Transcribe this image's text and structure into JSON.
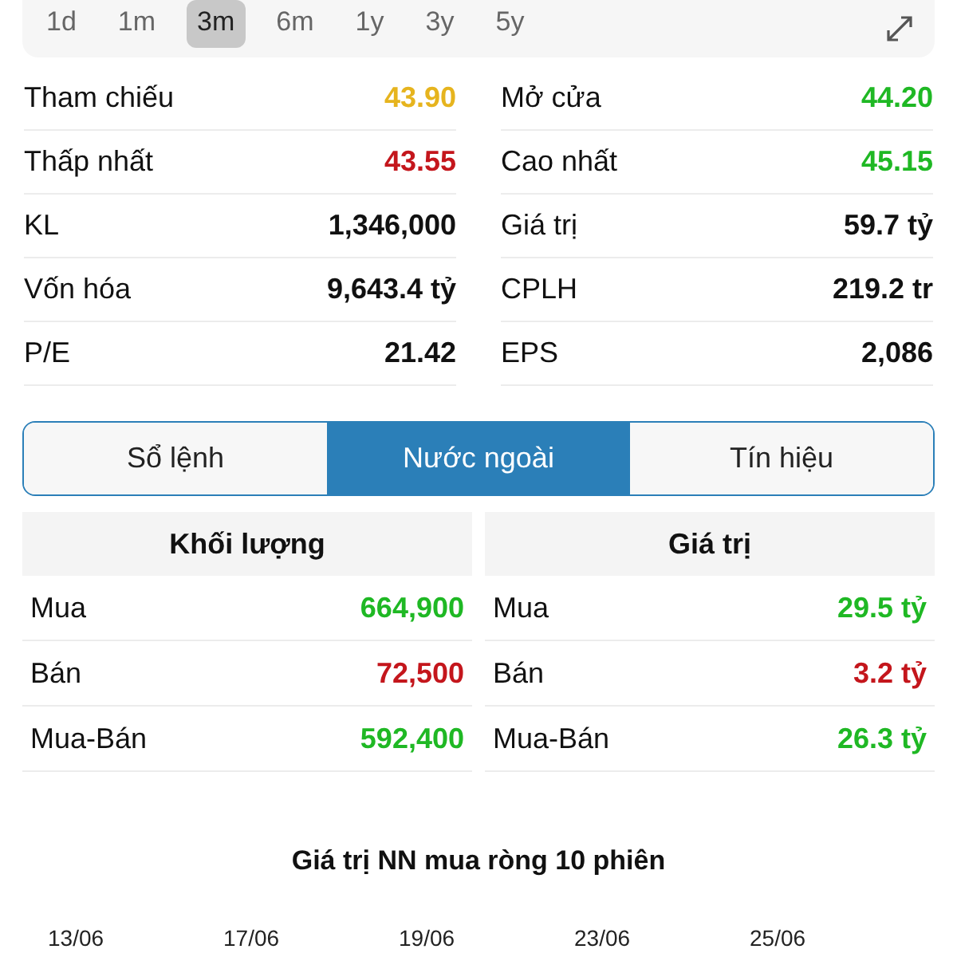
{
  "ranges": [
    {
      "label": "1d",
      "selected": false
    },
    {
      "label": "1m",
      "selected": false
    },
    {
      "label": "3m",
      "selected": true
    },
    {
      "label": "6m",
      "selected": false
    },
    {
      "label": "1y",
      "selected": false
    },
    {
      "label": "3y",
      "selected": false
    },
    {
      "label": "5y",
      "selected": false
    }
  ],
  "stats": [
    {
      "label": "Tham chiếu",
      "value": "43.90",
      "color": "#e6b41e"
    },
    {
      "label": "Mở cửa",
      "value": "44.20",
      "color": "#1fb824"
    },
    {
      "label": "Thấp nhất",
      "value": "43.55",
      "color": "#c4161c"
    },
    {
      "label": "Cao nhất",
      "value": "45.15",
      "color": "#1fb824"
    },
    {
      "label": "KL",
      "value": "1,346,000",
      "color": "#111111"
    },
    {
      "label": "Giá trị",
      "value": "59.7 tỷ",
      "color": "#111111"
    },
    {
      "label": "Vốn hóa",
      "value": "9,643.4 tỷ",
      "color": "#111111"
    },
    {
      "label": "CPLH",
      "value": "219.2 tr",
      "color": "#111111"
    },
    {
      "label": "P/E",
      "value": "21.42",
      "color": "#111111"
    },
    {
      "label": "EPS",
      "value": "2,086",
      "color": "#111111"
    }
  ],
  "tabs": [
    {
      "label": "Sổ lệnh",
      "selected": false
    },
    {
      "label": "Nước ngoài",
      "selected": true
    },
    {
      "label": "Tín hiệu",
      "selected": false
    }
  ],
  "tables": [
    {
      "heading": "Khối lượng",
      "rows": [
        {
          "label": "Mua",
          "value": "664,900",
          "color": "#1fb824"
        },
        {
          "label": "Bán",
          "value": "72,500",
          "color": "#c4161c"
        },
        {
          "label": "Mua-Bán",
          "value": "592,400",
          "color": "#1fb824"
        }
      ]
    },
    {
      "heading": "Giá trị",
      "rows": [
        {
          "label": "Mua",
          "value": "29.5 tỷ",
          "color": "#1fb824"
        },
        {
          "label": "Bán",
          "value": "3.2 tỷ",
          "color": "#c4161c"
        },
        {
          "label": "Mua-Bán",
          "value": "26.3 tỷ",
          "color": "#1fb824"
        }
      ]
    }
  ],
  "chart": {
    "title": "Giá trị NN mua ròng 10 phiên",
    "date_labels": [
      "13/06",
      "17/06",
      "19/06",
      "23/06",
      "25/06"
    ]
  }
}
